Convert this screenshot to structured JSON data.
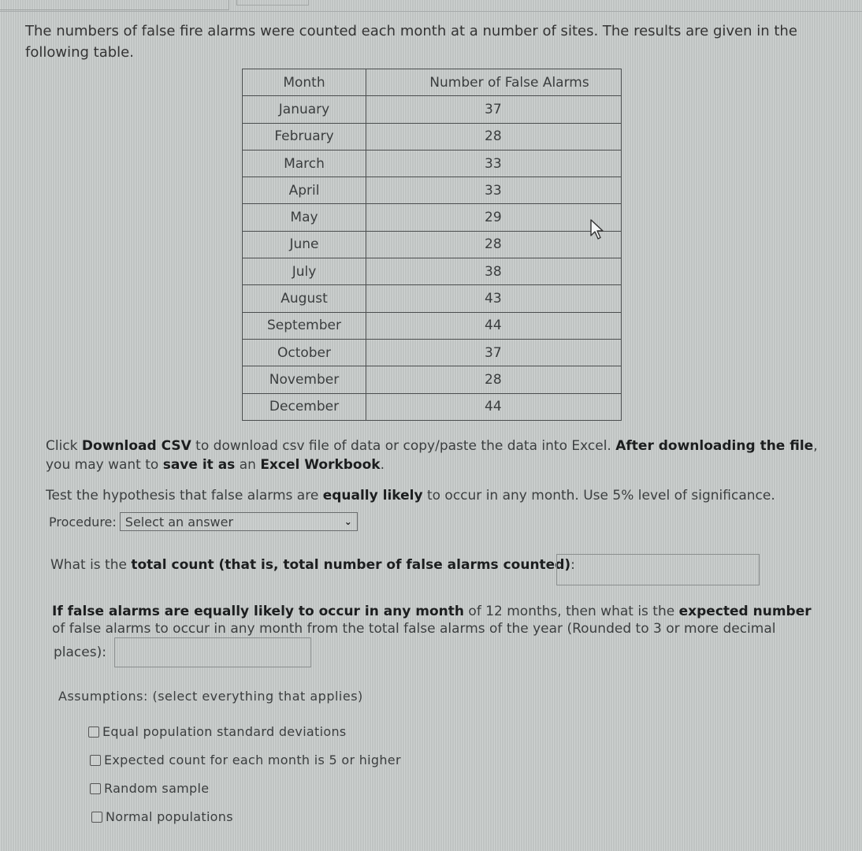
{
  "intro": "The numbers of false fire alarms were counted each month at a number of sites. The results are given in the following table.",
  "table": {
    "headers": [
      "Month",
      "Number of False Alarms"
    ],
    "rows": [
      {
        "month": "January",
        "count": "37"
      },
      {
        "month": "February",
        "count": "28"
      },
      {
        "month": "March",
        "count": "33"
      },
      {
        "month": "April",
        "count": "33"
      },
      {
        "month": "May",
        "count": "29"
      },
      {
        "month": "June",
        "count": "28"
      },
      {
        "month": "July",
        "count": "38"
      },
      {
        "month": "August",
        "count": "43"
      },
      {
        "month": "September",
        "count": "44"
      },
      {
        "month": "October",
        "count": "37"
      },
      {
        "month": "November",
        "count": "28"
      },
      {
        "month": "December",
        "count": "44"
      }
    ]
  },
  "instructions": {
    "p1": {
      "t1": "Click ",
      "b1": "Download CSV",
      "t2": " to download csv file of data or copy/paste the data into Excel. ",
      "b2": "After downloading the file",
      "t3": ", you may want to ",
      "b3": "save it as",
      "t4": " an ",
      "b4": "Excel Workbook",
      "t5": "."
    },
    "p2": {
      "t1": "Test the hypothesis that false alarms are ",
      "b1": "equally likely",
      "t2": " to occur in any month. Use 5% level of significance."
    }
  },
  "procedure": {
    "label": "Procedure:",
    "selected": "Select an answer"
  },
  "question_total": {
    "t1": "What is the ",
    "b1": "total count (that is, total number of false alarms counted)",
    "t2": ":",
    "value": ""
  },
  "question_expected": {
    "b1": "If false alarms are equally likely to occur in any month",
    "t1": " of 12 months, then what is the ",
    "b2": "expected number",
    "t2": " of false alarms to occur in any month from the total false alarms of the year (Rounded to 3 or more decimal",
    "t3": "places):",
    "value": ""
  },
  "assumptions": {
    "label": "Assumptions: (select everything that applies)",
    "options": [
      {
        "label": "Equal population standard deviations",
        "checked": false
      },
      {
        "label": "Expected count for each month is 5 or higher",
        "checked": false
      },
      {
        "label": "Random sample",
        "checked": false
      },
      {
        "label": "Normal populations",
        "checked": false
      }
    ]
  }
}
